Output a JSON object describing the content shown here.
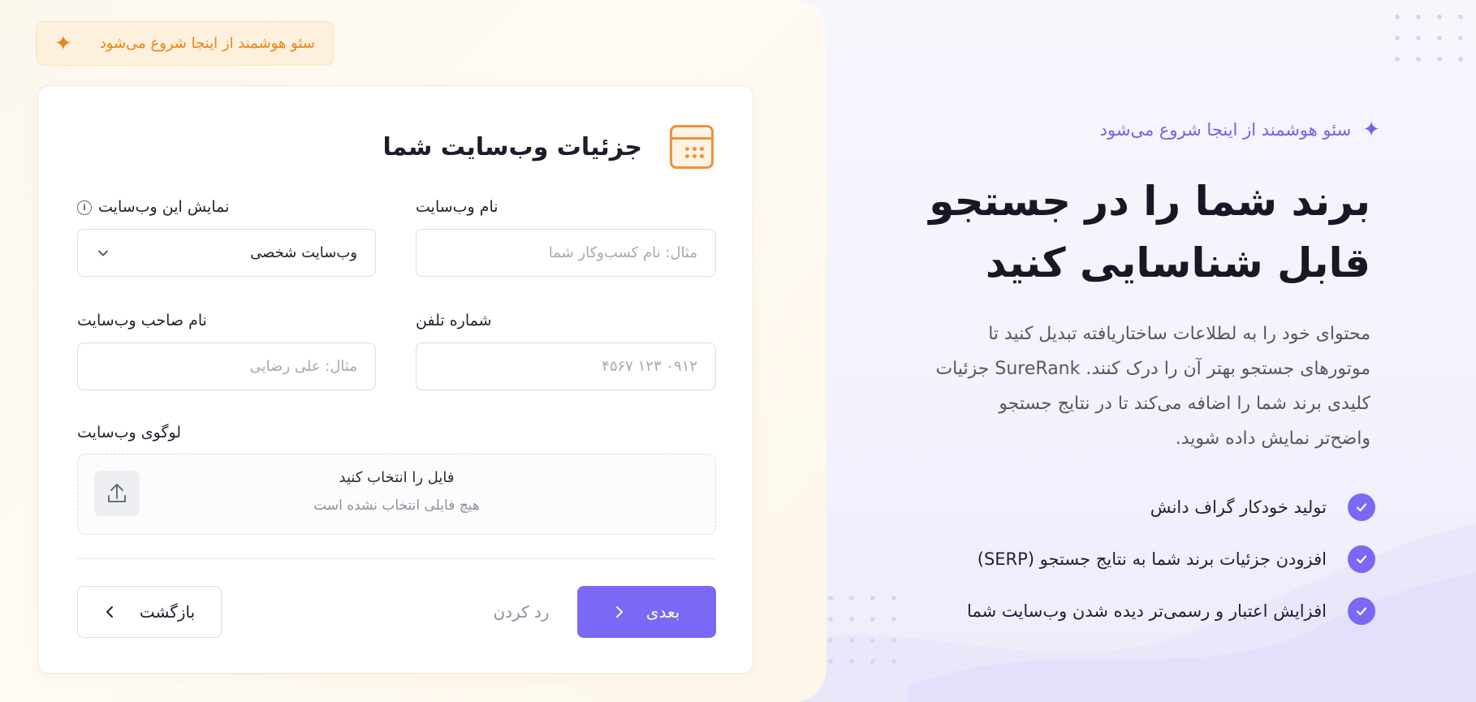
{
  "left": {
    "badge_text": "سئو هوشمند از اینجا شروع می‌شود",
    "card_title": "جزئیات وب‌سایت شما",
    "fields": {
      "website_name": {
        "label": "نام وب‌سایت",
        "placeholder": "مثال: نام کسب‌وکار شما"
      },
      "display_as": {
        "label": "نمایش این وب‌سایت",
        "value": "وب‌سایت شخصی"
      },
      "phone": {
        "label": "شماره تلفن",
        "placeholder": "۰۹۱۲ ۱۲۳ ۴۵۶۷"
      },
      "owner_name": {
        "label": "نام صاحب وب‌سایت",
        "placeholder": "مثال: علی رضایی"
      },
      "logo": {
        "label": "لوگوی وب‌سایت",
        "choose_text": "فایل را انتخاب کنید",
        "no_file_text": "هیچ فایلی انتخاب نشده است"
      }
    },
    "buttons": {
      "back": "بازگشت",
      "cancel": "رد کردن",
      "next": "بعدی"
    },
    "colors": {
      "accent": "#7b68f5",
      "orange": "#e8841b"
    },
    "icons": {
      "badge": "sparkle-icon",
      "card": "browser-window-icon",
      "info": "info-icon",
      "dropdown": "chevron-down-icon",
      "upload": "upload-icon",
      "back": "chevron-left-icon",
      "next": "chevron-right-icon"
    }
  },
  "right": {
    "badge_text": "سئو هوشمند از اینجا شروع می‌شود",
    "hero_line1": "برند شما را در جستجو",
    "hero_line2": "قابل شناسایی کنید",
    "paragraph_lines": [
      "محتوای خود را به لطلاعات ساختاریافته تبدیل کنید تا",
      "موتورهای جستجو بهتر آن را درک کنند. SureRank جزئیات",
      "کلیدی برند شما را اضافه می‌کند تا در نتایج جستجو",
      "واضح‌تر نمایش داده شوید."
    ],
    "features": [
      "تولید خودکار گراف دانش",
      "افزودن جزئیات برند شما به نتایج جستجو (SERP)",
      "افزایش اعتبار و رسمی‌تر دیده شدن وب‌سایت شما"
    ],
    "colors": {
      "accent": "#7462e8"
    }
  }
}
